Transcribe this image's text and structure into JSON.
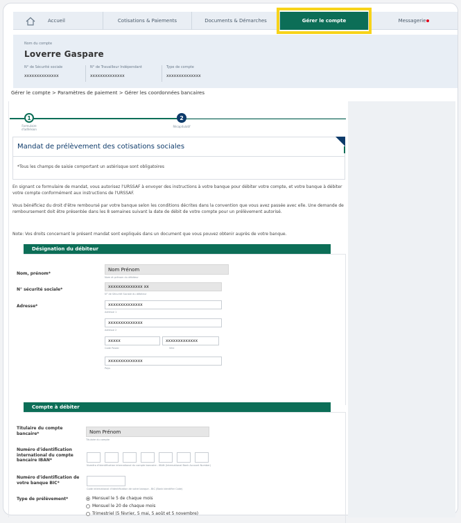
{
  "nav": {
    "items": [
      {
        "label": "Accueil",
        "icon": "home-icon"
      },
      {
        "label": "Cotisations & Paiements"
      },
      {
        "label": "Documents & Démarches"
      },
      {
        "label": "Gérer le compte",
        "active": true
      },
      {
        "label": "Messagerie",
        "badge_color": "#e2001a"
      }
    ]
  },
  "account": {
    "caption": "Nom du compte",
    "name": "Loverre Gaspare",
    "fields": [
      {
        "label": "N° de Sécurité sociale",
        "value": "xxxxxxxxxxxxxx"
      },
      {
        "label": "N° de Travailleur Indépendant",
        "value": "xxxxxxxxxxxxxx"
      },
      {
        "label": "Type de compte",
        "value": "xxxxxxxxxxxxxx"
      }
    ]
  },
  "breadcrumb": "Gérer le compte > Paramètres de paiement > Gérer les coordonnées bancaires",
  "stepper": {
    "steps": [
      {
        "number": "1",
        "label": "Formulaire d'adhésion"
      },
      {
        "number": "2",
        "label": "Récapitulatif"
      }
    ]
  },
  "mandate": {
    "title": "Mandat de prélèvement des cotisations sociales",
    "note": "*Tous les champs de saisie comportant un astérisque sont obligatoires"
  },
  "paragraphs": [
    "En signant ce formulaire de mandat, vous autorisez l'URSSAF à envoyer des instructions à votre banque pour débiter votre compte, et votre banque à débiter votre compte conformément aux instructions de l'URSSAF.",
    "Vous bénéficiez du droit d'être remboursé par votre banque selon les conditions décrites dans la convention que vous avez passée avec elle. Une demande de remboursement doit être présentée dans les 8 semaines suivant la date de débit de votre compte pour un prélèvement autorisé.",
    "Note: Vos droits concernant le présent mandat sont expliqués dans un document que vous pouvez obtenir auprès de votre banque."
  ],
  "debtor": {
    "section_title": "Désignation du débiteur",
    "name_label": "Nom, prénom*",
    "name_value": "Nom Prénom",
    "name_hint": "Nom et prénom du débiteur",
    "ss_label": "N° sécurité sociale*",
    "ss_value": "xxxxxxxxxxxxxx xx",
    "ss_hint": "N° de Sécurité Sociale du débiteur",
    "address_label": "Adresse*",
    "address1": "xxxxxxxxxxxxxx",
    "address1_hint": "Adresse 1",
    "address2": "xxxxxxxxxxxxxx",
    "address2_hint": "Adresse 2",
    "postal": "xxxxx",
    "postal_hint": "Code Postal",
    "city": "xxxxxxxxxxxxx",
    "city_hint": "Ville",
    "country": "xxxxxxxxxxxxxx",
    "country_hint": "Pays"
  },
  "account_debit": {
    "section_title": "Compte à débiter",
    "holder_label": "Titulaire du compte bancaire*",
    "holder_value": "Nom Prénom",
    "holder_hint": "Titulaire du compte",
    "iban_label": "Numéro d'identification international du compte bancaire IBAN*",
    "iban_hint": "Numéro d'identification international du compte bancaire - IBAN (International Bank Account Number)",
    "bic_label": "Numéro d'identification de votre banque BIC*",
    "bic_hint": "Code international d'identification de votre banque - BIC (Bank Identifier Code)",
    "type_label": "Type de prélèvement*",
    "options": [
      {
        "label": "Mensuel le 5 de chaque mois",
        "selected": true
      },
      {
        "label": "Mensuel le 20 de chaque mois",
        "selected": false
      },
      {
        "label": "Trimestriel (5 février, 5 mai, 5 août et 5 novembre)",
        "selected": false
      }
    ]
  }
}
